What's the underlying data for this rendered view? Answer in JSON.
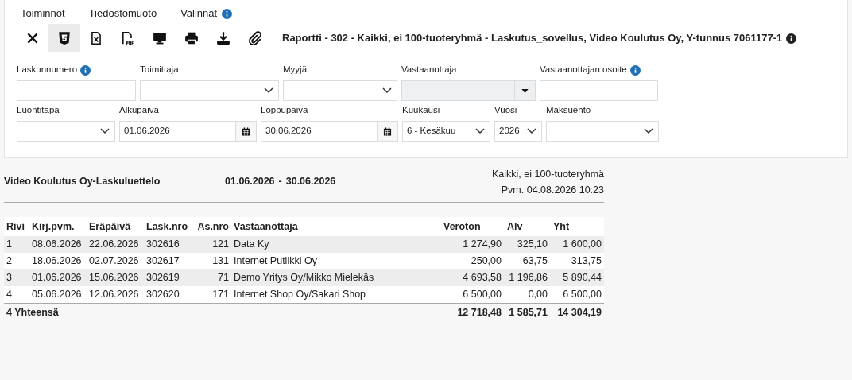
{
  "menu": [
    {
      "label": "Toiminnot",
      "info": false
    },
    {
      "label": "Tiedostomuoto",
      "info": false
    },
    {
      "label": "Valinnat",
      "info": true
    }
  ],
  "toolbar": [
    {
      "kind": "close",
      "selected": false
    },
    {
      "kind": "html",
      "selected": true
    },
    {
      "kind": "excel",
      "selected": false
    },
    {
      "kind": "pdf",
      "selected": false
    },
    {
      "kind": "screen",
      "selected": false
    },
    {
      "kind": "print",
      "selected": false
    },
    {
      "kind": "download",
      "selected": false
    },
    {
      "kind": "attach",
      "selected": false
    }
  ],
  "report_title": "Raportti - 302 - Kaikki, ei 100-tuoteryhmä - Laskutus_sovellus, Video Koulutus Oy, Y-tunnus 7061177-1",
  "filter_rows": [
    [
      {
        "label": "Laskunnumero",
        "kind": "text",
        "info": true,
        "disabled": false
      },
      {
        "label": "Toimittaja",
        "kind": "select",
        "info": false,
        "disabled": false
      },
      {
        "label": "Myyjä",
        "kind": "select",
        "info": false,
        "disabled": false
      },
      {
        "label": "Vastaanottaja",
        "kind": "combo",
        "info": false,
        "disabled": true
      },
      {
        "label": "Vastaanottajan osoite",
        "kind": "text",
        "info": true,
        "disabled": false
      }
    ],
    [
      {
        "label": "Luontitapa",
        "kind": "select",
        "info": false,
        "disabled": false
      },
      {
        "label": "Alkupäivä",
        "kind": "date",
        "value": "01.06.2026",
        "info": false,
        "disabled": false
      },
      {
        "label": "Loppupäivä",
        "kind": "date",
        "value": "30.06.2026",
        "info": false,
        "disabled": false
      },
      {
        "label": "Kuukausi",
        "kind": "select",
        "value": "6 - Kesäkuu",
        "info": false,
        "disabled": false
      },
      {
        "label": "Vuosi",
        "kind": "select",
        "value": "2026",
        "info": false,
        "disabled": false
      },
      {
        "label": "Maksuehto",
        "kind": "select",
        "info": false,
        "disabled": false
      }
    ]
  ],
  "list_header": {
    "title": "Video Koulutus Oy-Laskuluettelo",
    "start": "01.06.2026",
    "separator": "-",
    "end": "30.06.2026",
    "scope": "Kaikki, ei 100-tuoteryhmä",
    "printed": "Pvm. 04.08.2026 10:23"
  },
  "table": {
    "columns": [
      "Rivi",
      "Kirj.pvm.",
      "Eräpäivä",
      "Lask.nro",
      "As.nro",
      "Vastaanottaja",
      "Veroton",
      "Alv",
      "Yht"
    ],
    "rows": [
      [
        "1",
        "08.06.2026",
        "22.06.2026",
        "302616",
        "121",
        "Data Ky",
        "1 274,90",
        "325,10",
        "1 600,00"
      ],
      [
        "2",
        "18.06.2026",
        "02.07.2026",
        "302617",
        "131",
        "Internet Putiikki Oy",
        "250,00",
        "63,75",
        "313,75"
      ],
      [
        "3",
        "01.06.2026",
        "15.06.2026",
        "302619",
        "71",
        "Demo Yritys Oy/Mikko Mielekäs",
        "4 693,58",
        "1 196,86",
        "5 890,44"
      ],
      [
        "4",
        "05.06.2026",
        "12.06.2026",
        "302620",
        "171",
        "Internet Shop Oy/Sakari Shop",
        "6 500,00",
        "0,00",
        "6 500,00"
      ]
    ],
    "total": {
      "label": "4 Yhteensä",
      "veroton": "12 718,48",
      "alv": "1 585,71",
      "yht": "14 304,19"
    }
  }
}
